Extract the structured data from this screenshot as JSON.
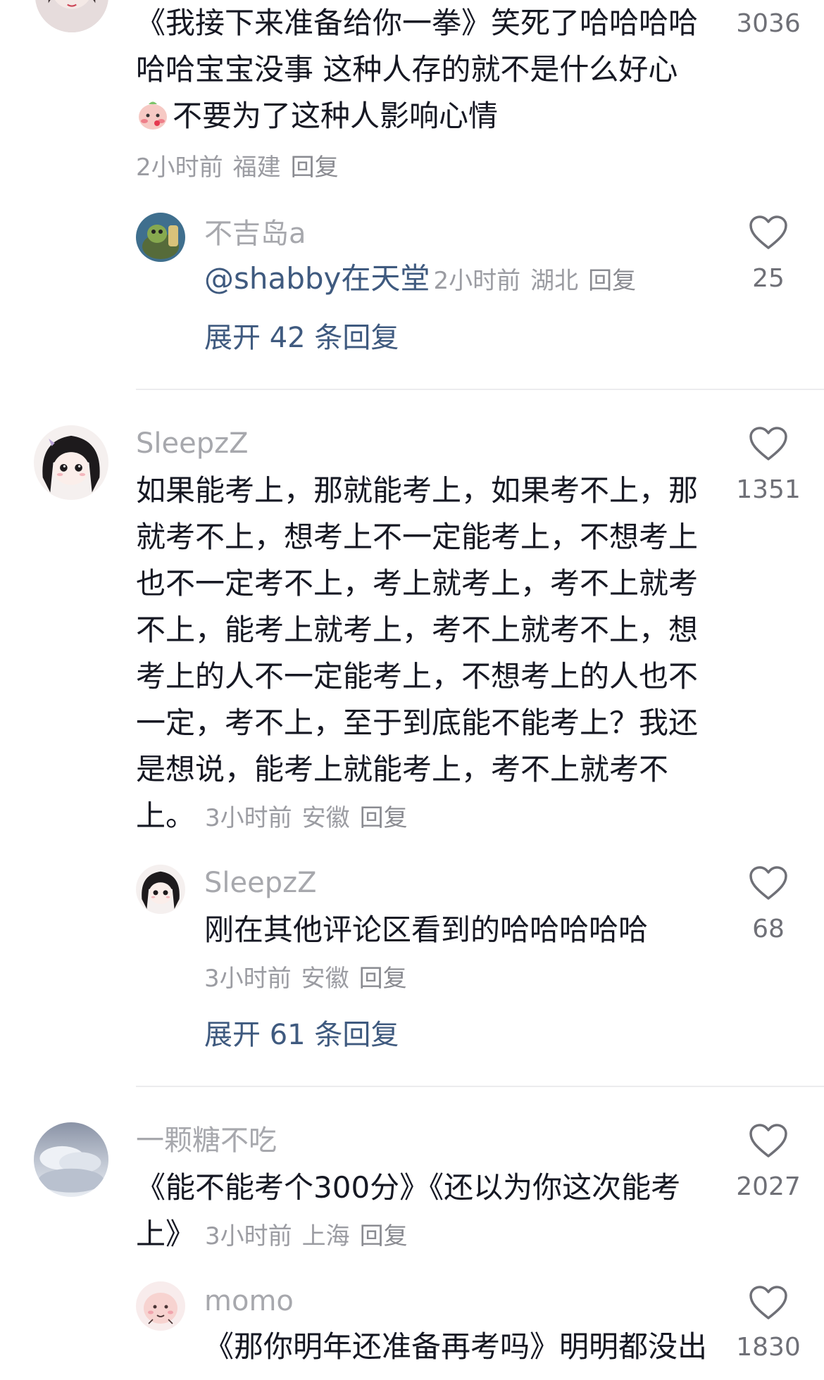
{
  "comments": [
    {
      "id": "c1",
      "text_lines": [
        "《我接下来准备给你一拳》笑死了哈哈哈哈",
        "哈哈宝宝没事 这种人存的就不是什么好心",
        "不要为了这种人影响心情"
      ],
      "emoji": "blushing-face-emoji",
      "time": "2小时前",
      "location": "福建",
      "reply_label": "回复",
      "likes": "3036",
      "replies": [
        {
          "username": "不吉岛a",
          "mention": "@shabby在天堂",
          "time": "2小时前",
          "location": "湖北",
          "reply_label": "回复",
          "likes": "25"
        }
      ],
      "expand_label": "展开 42 条回复"
    },
    {
      "id": "c2",
      "username": "SleepzZ",
      "text_lines": [
        "如果能考上，那就能考上，如果考不上，那",
        "就考不上，想考上不一定能考上，不想考上",
        "也不一定考不上，考上就考上，考不上就考",
        "不上，能考上就考上，考不上就考不上，想",
        "考上的人不一定能考上，不想考上的人也不",
        "一定，考不上，至于到底能不能考上？我还",
        "是想说，能考上就能考上，考不上就考不",
        "上。"
      ],
      "time": "3小时前",
      "location": "安徽",
      "reply_label": "回复",
      "likes": "1351",
      "replies": [
        {
          "username": "SleepzZ",
          "text": "刚在其他评论区看到的哈哈哈哈哈",
          "time": "3小时前",
          "location": "安徽",
          "reply_label": "回复",
          "likes": "68"
        }
      ],
      "expand_label": "展开 61 条回复"
    },
    {
      "id": "c3",
      "username": "一颗糖不吃",
      "text_lines": [
        "《能不能考个300分》《还以为你这次能考",
        "上》"
      ],
      "time": "3小时前",
      "location": "上海",
      "reply_label": "回复",
      "likes": "2027",
      "replies": [
        {
          "username": "momo",
          "text": "《那你明年还准备再考吗》明明都没出",
          "likes": "1830"
        }
      ]
    }
  ],
  "colors": {
    "text": "#161823",
    "meta": "#9b9ca2",
    "link": "#3f5a7f",
    "username": "#a7a8ad"
  }
}
